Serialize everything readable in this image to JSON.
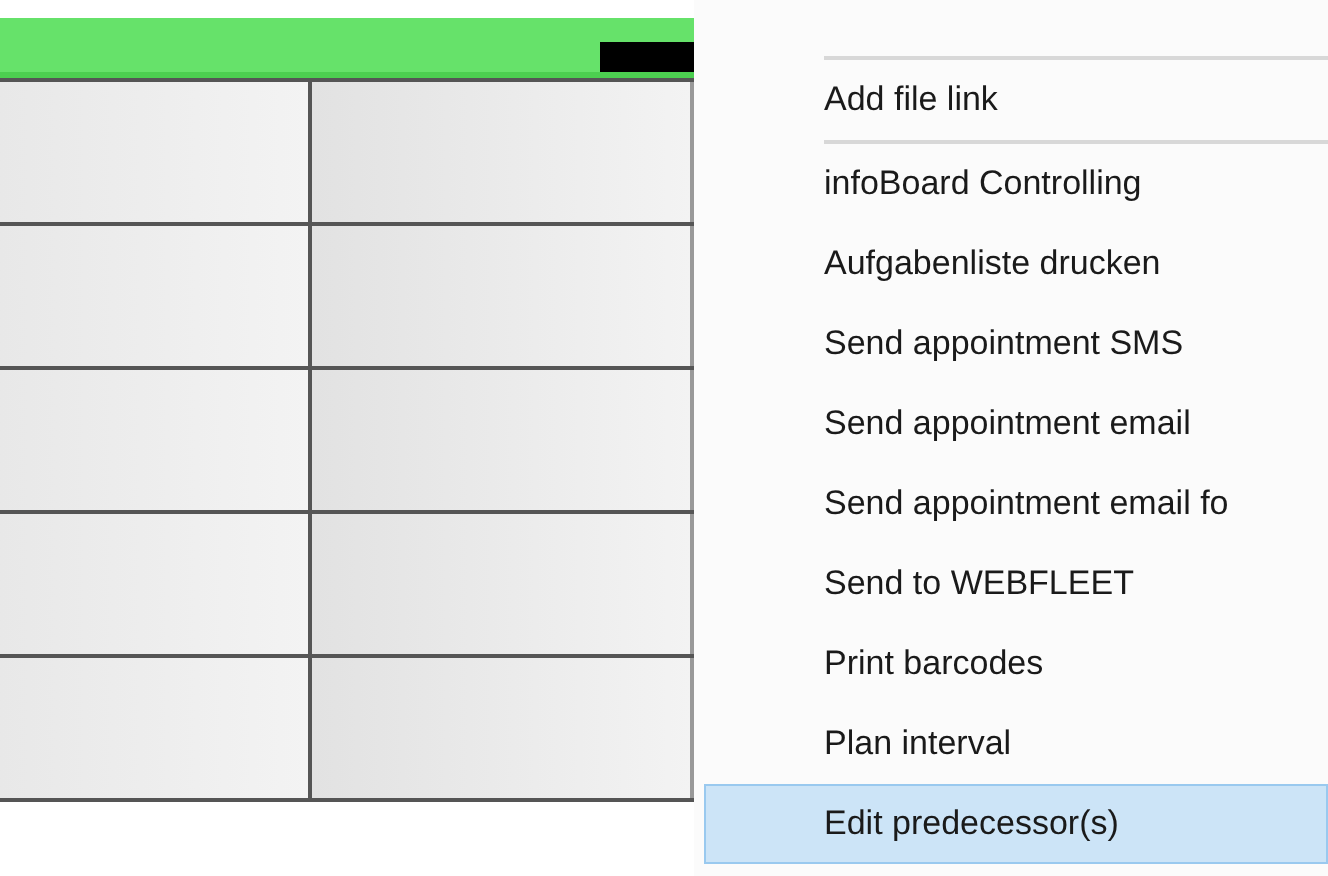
{
  "context_menu": {
    "items": [
      {
        "kind": "separator"
      },
      {
        "kind": "item",
        "label": "Add file link",
        "selected": false
      },
      {
        "kind": "separator"
      },
      {
        "kind": "item",
        "label": "infoBoard Controlling",
        "selected": false
      },
      {
        "kind": "item",
        "label": "Aufgabenliste drucken",
        "selected": false
      },
      {
        "kind": "item",
        "label": "Send appointment SMS",
        "selected": false
      },
      {
        "kind": "item",
        "label": "Send appointment email",
        "selected": false
      },
      {
        "kind": "item",
        "label": "Send appointment email fo",
        "selected": false
      },
      {
        "kind": "item",
        "label": "Send to WEBFLEET",
        "selected": false
      },
      {
        "kind": "item",
        "label": "Print barcodes",
        "selected": false
      },
      {
        "kind": "item",
        "label": "Plan interval",
        "selected": false
      },
      {
        "kind": "item",
        "label": "Edit predecessor(s)",
        "selected": true
      }
    ]
  }
}
